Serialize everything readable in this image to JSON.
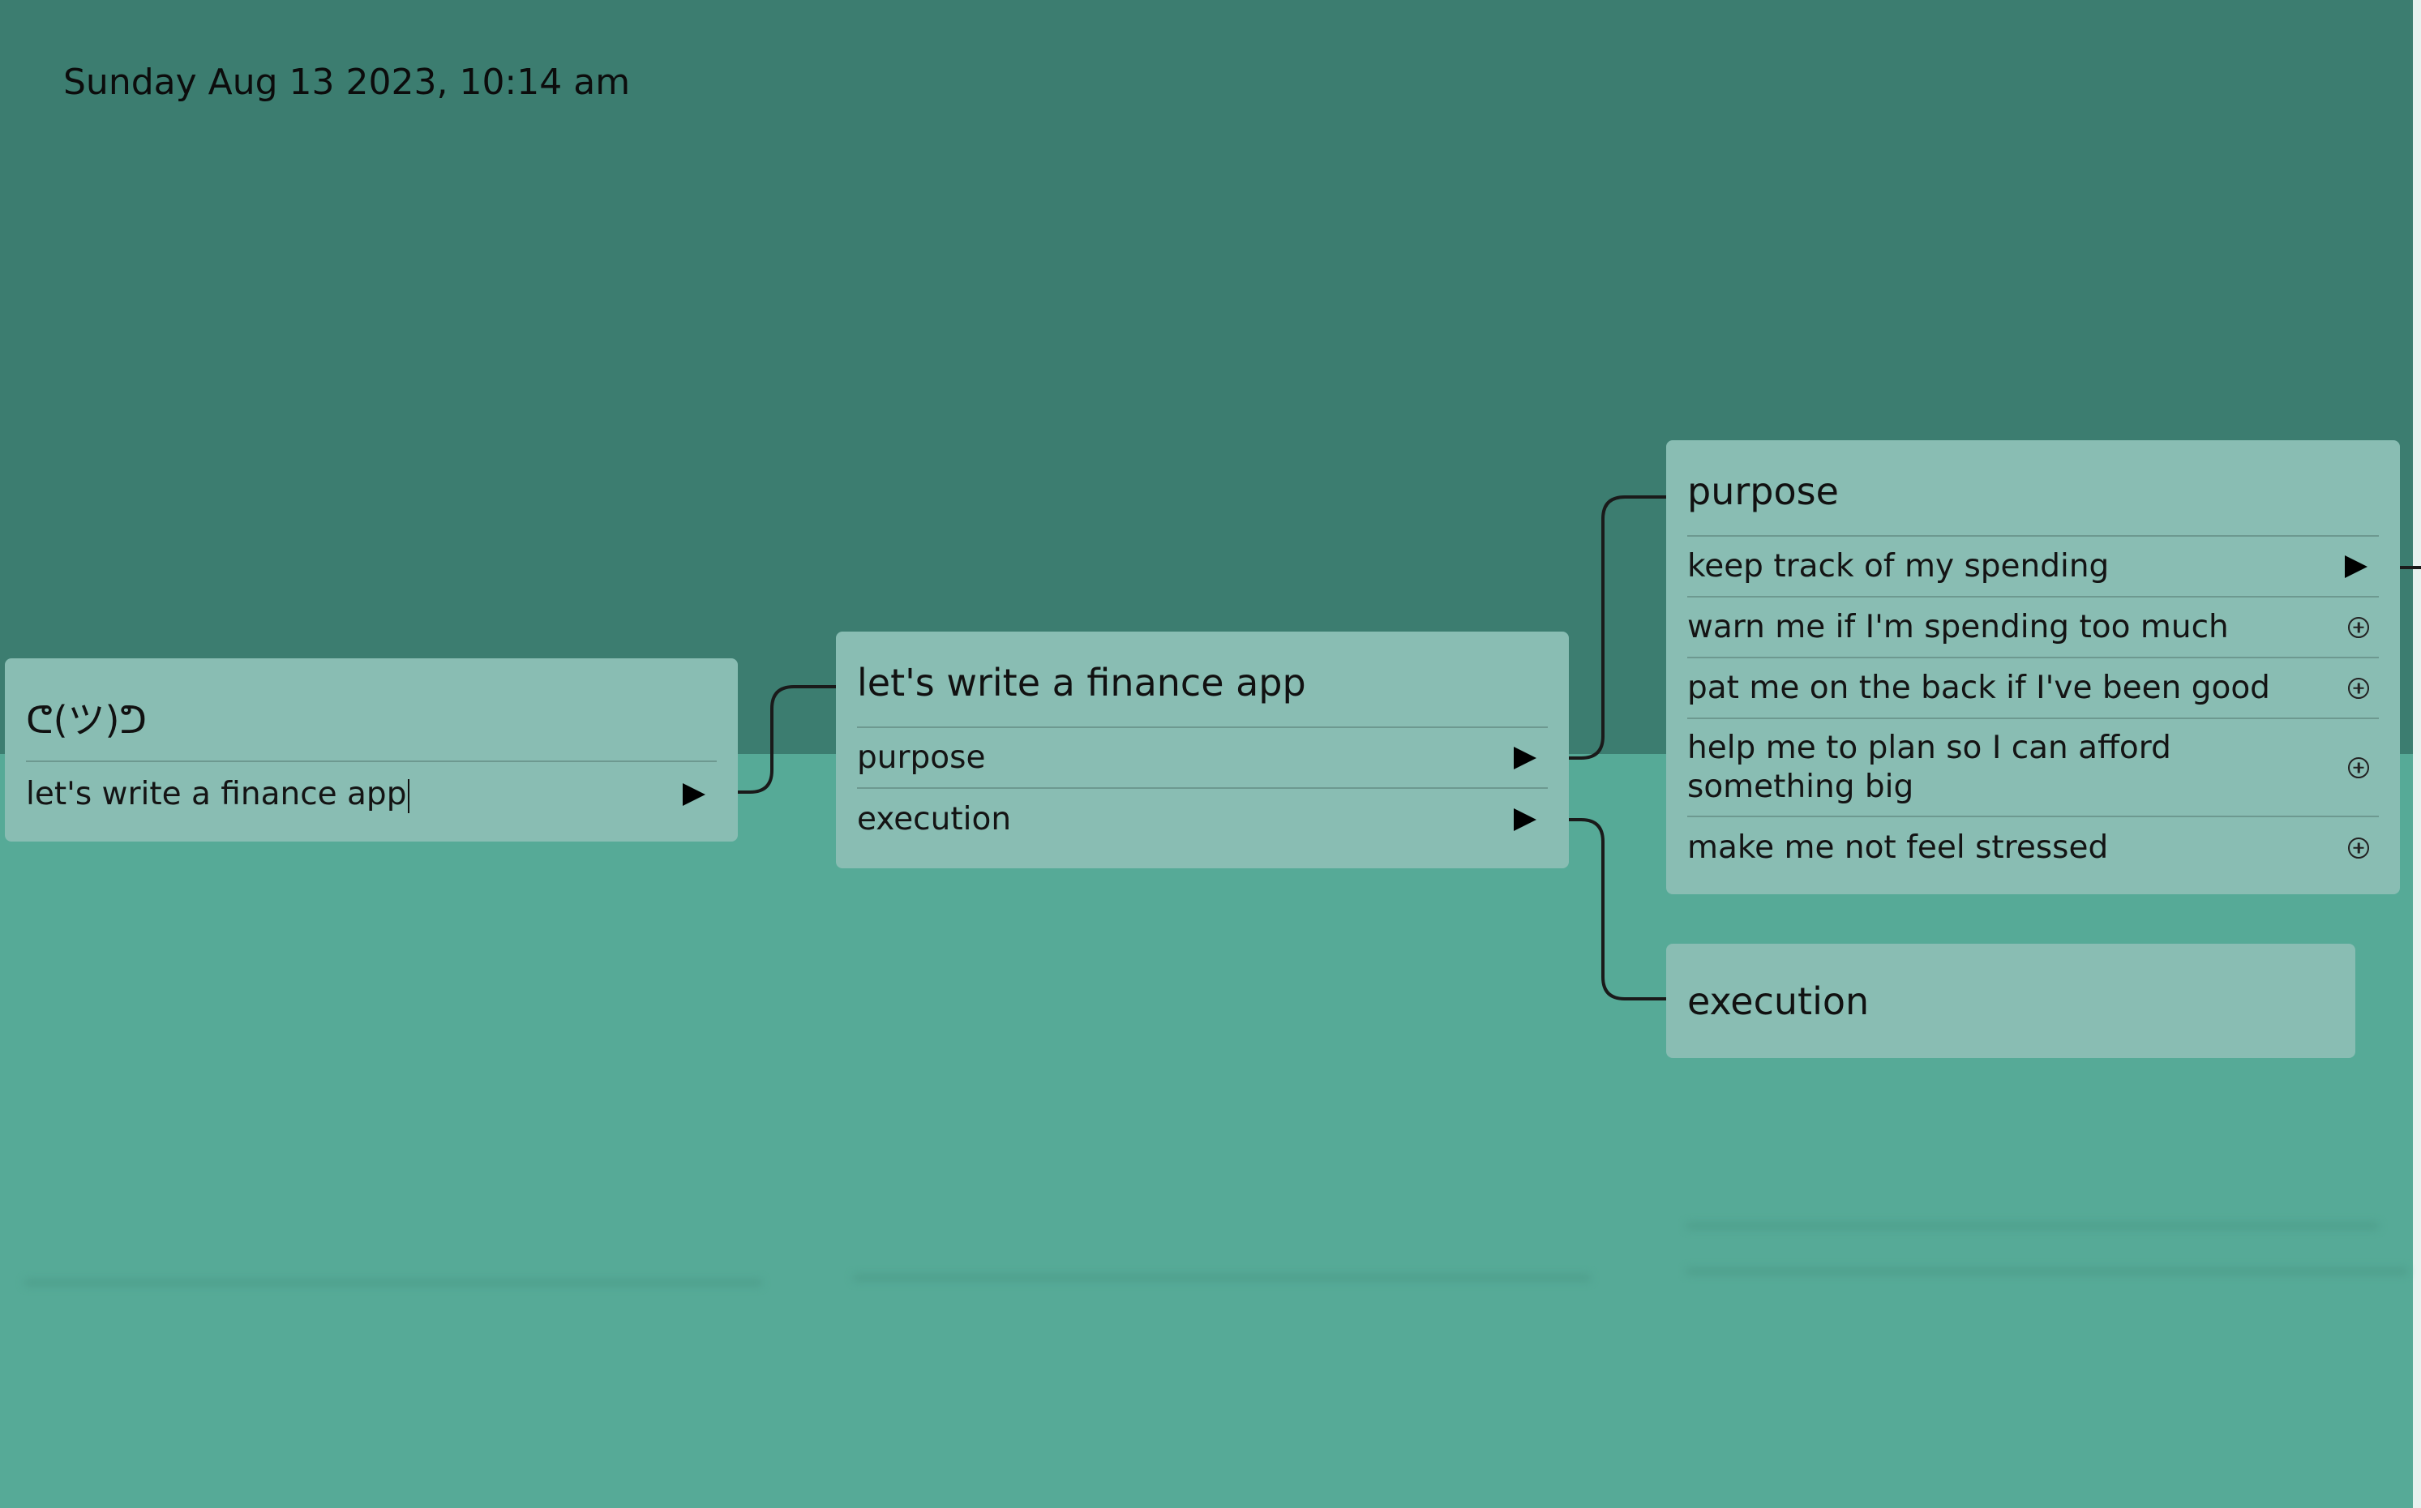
{
  "timestamp": "Sunday Aug 13 2023, 10:14 am",
  "colors": {
    "background_top": "#3c7d70",
    "background_bottom": "#56aa97",
    "card": "#89bdb3",
    "connector": "#1a1a1a"
  },
  "root_card": {
    "title": "ᕦ(ツ)ᕤ",
    "items": [
      {
        "label": "let's write a finance app",
        "control": "expand-arrow-icon"
      }
    ]
  },
  "app_card": {
    "title": "let's write a finance app",
    "items": [
      {
        "label": "purpose",
        "control": "expand-arrow-icon"
      },
      {
        "label": "execution",
        "control": "expand-arrow-icon"
      }
    ]
  },
  "purpose_card": {
    "title": "purpose",
    "items": [
      {
        "label": "keep track of my spending",
        "control": "expand-arrow-icon"
      },
      {
        "label": "warn me if I'm spending too much",
        "control": "add-circle-icon"
      },
      {
        "label": "pat me on the back if I've been good",
        "control": "add-circle-icon"
      },
      {
        "label": "help me to plan so I can afford something big",
        "control": "add-circle-icon"
      },
      {
        "label": "make me not feel stressed",
        "control": "add-circle-icon"
      }
    ]
  },
  "execution_card": {
    "title": "execution"
  }
}
